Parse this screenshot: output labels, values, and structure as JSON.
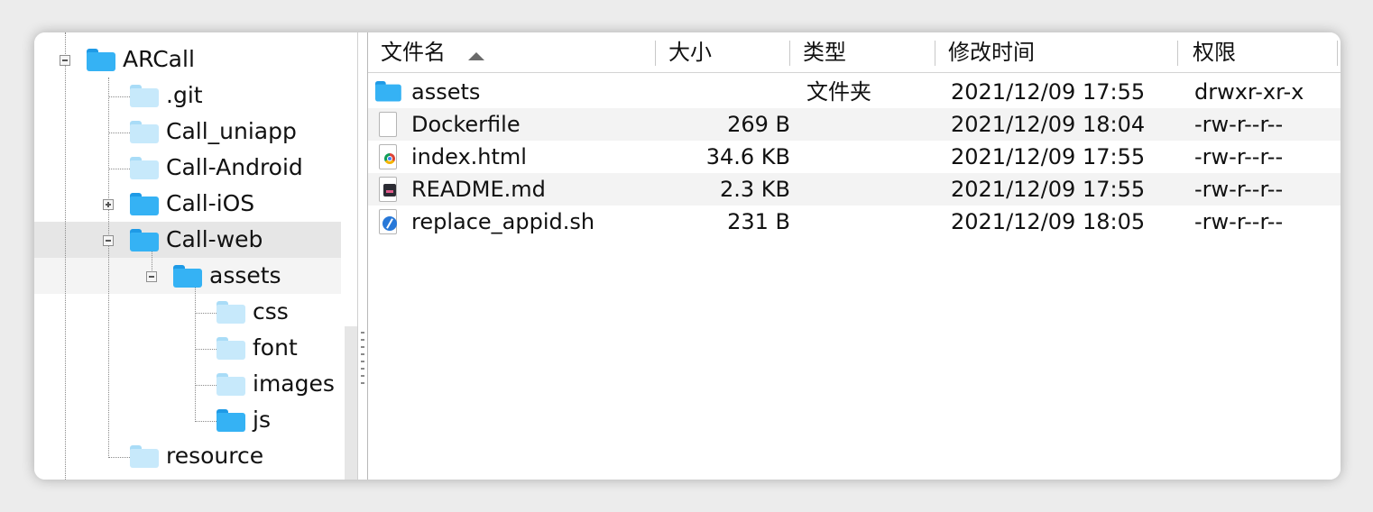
{
  "colors": {
    "folder_light": "#c7e9fb",
    "folder_dark": "#35b2f4",
    "selection_row": "#e6e6e6",
    "selection_row_faint": "#f4f4f4",
    "alt_row": "#f3f3f3"
  },
  "tree": {
    "items": [
      {
        "label": "ARCall",
        "icon": "folder-icon",
        "expander": "minus"
      },
      {
        "label": ".git",
        "icon": "folder-icon"
      },
      {
        "label": "Call_uniapp",
        "icon": "folder-icon"
      },
      {
        "label": "Call-Android",
        "icon": "folder-icon"
      },
      {
        "label": "Call-iOS",
        "icon": "folder-icon",
        "expander": "plus"
      },
      {
        "label": "Call-web",
        "icon": "folder-icon",
        "expander": "minus",
        "selected": true
      },
      {
        "label": "assets",
        "icon": "folder-icon",
        "expander": "minus"
      },
      {
        "label": "css",
        "icon": "folder-icon"
      },
      {
        "label": "font",
        "icon": "folder-icon"
      },
      {
        "label": "images",
        "icon": "folder-icon"
      },
      {
        "label": "js",
        "icon": "folder-icon"
      },
      {
        "label": "resource",
        "icon": "folder-icon"
      }
    ]
  },
  "file_list": {
    "columns": {
      "name": "文件名",
      "size": "大小",
      "type": "类型",
      "modified": "修改时间",
      "permissions": "权限"
    },
    "sort_indicator": "sort-ascending-icon",
    "rows": [
      {
        "name": "assets",
        "size": "",
        "type": "文件夹",
        "modified": "2021/12/09 17:55",
        "permissions": "drwxr-xr-x",
        "icon": "folder-icon"
      },
      {
        "name": "Dockerfile",
        "size": "269 B",
        "type": "",
        "modified": "2021/12/09 18:04",
        "permissions": "-rw-r--r--",
        "icon": "file-icon"
      },
      {
        "name": "index.html",
        "size": "34.6 KB",
        "type": "",
        "modified": "2021/12/09 17:55",
        "permissions": "-rw-r--r--",
        "icon": "html-file-icon"
      },
      {
        "name": "README.md",
        "size": "2.3 KB",
        "type": "",
        "modified": "2021/12/09 17:55",
        "permissions": "-rw-r--r--",
        "icon": "markdown-file-icon"
      },
      {
        "name": "replace_appid.sh",
        "size": "231 B",
        "type": "",
        "modified": "2021/12/09 18:05",
        "permissions": "-rw-r--r--",
        "icon": "shell-script-icon"
      }
    ]
  }
}
